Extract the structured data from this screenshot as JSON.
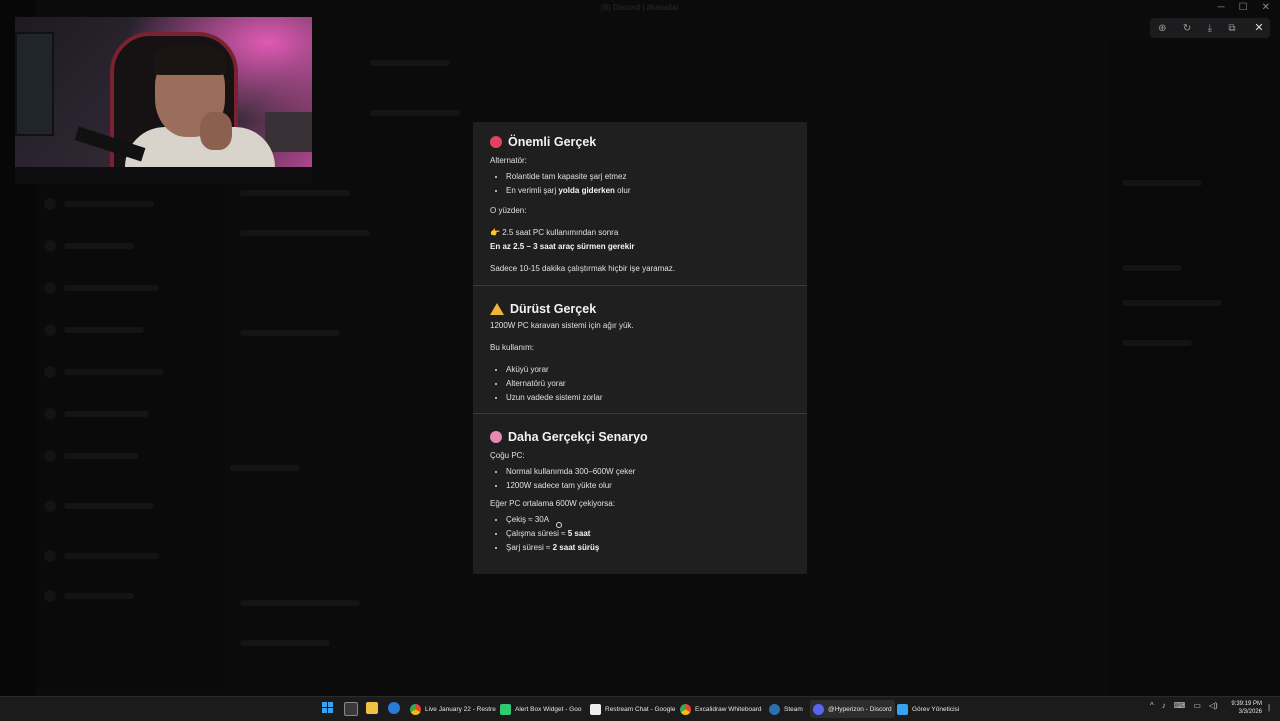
{
  "background_app": {
    "title": "(8) Discord | #kanallar"
  },
  "viewer_tools": [
    "zoom-in-icon",
    "rotate-icon",
    "download-icon",
    "open-external-icon",
    "more-icon"
  ],
  "webcam": {
    "label": "Streamer webcam"
  },
  "popup": {
    "section1": {
      "icon": "red-circle-icon",
      "title": "Önemli Gerçek",
      "intro": "Alternatör:",
      "bullets": [
        {
          "pre": "Rolantide tam kapasite şarj etmez",
          "bold": "",
          "post": ""
        },
        {
          "pre": "En verimli şarj ",
          "bold": "yolda giderken",
          "post": " olur"
        }
      ],
      "therefore": "O yüzden:",
      "point_icon": "👉",
      "point_text": "2.5 saat PC kullanımından sonra",
      "point_bold": "En az 2.5 – 3 saat araç sürmen gerekir",
      "note": "Sadece 10-15 dakika çalıştırmak hiçbir işe yaramaz."
    },
    "section2": {
      "icon": "warning-icon",
      "title": "Dürüst Gerçek",
      "intro": "1200W PC karavan sistemi için ağır yük.",
      "lead": "Bu kullanım:",
      "bullets": [
        "Aküyü yorar",
        "Alternatörü yorar",
        "Uzun vadede sistemi zorlar"
      ]
    },
    "section3": {
      "icon": "brain-icon",
      "title": "Daha Gerçekçi Senaryo",
      "intro": "Çoğu PC:",
      "bullets": [
        "Normal kullanımda 300–600W çeker",
        "1200W sadece tam yükte olur"
      ],
      "lead": "Eğer PC ortalama 600W çekiyorsa:",
      "calc": [
        {
          "pre": "Çekiş ≈ 30A",
          "bold": ""
        },
        {
          "pre": "Çalışma süresi ≈ ",
          "bold": "5 saat"
        },
        {
          "pre": "Şarj süresi ≈ ",
          "bold": "2 saat sürüş"
        }
      ]
    }
  },
  "taskbar": {
    "apps": [
      {
        "label": "Live January 22 - Restre",
        "color": "#4caf50"
      },
      {
        "label": "Alert Box Widget - Goo",
        "color": "#2ecc71"
      },
      {
        "label": "Restream Chat - Google",
        "color": "#eeeeee"
      },
      {
        "label": "Excalidraw Whiteboard",
        "color": "#4caf50"
      },
      {
        "label": "Steam",
        "color": "#2a6fb0"
      },
      {
        "label": "@Hyperizon - Discord",
        "color": "#5865f2"
      },
      {
        "label": "Görev Yöneticisi",
        "color": "#3aa0f0"
      }
    ],
    "time": "9:39:19 PM",
    "date": "3/3/2026"
  }
}
